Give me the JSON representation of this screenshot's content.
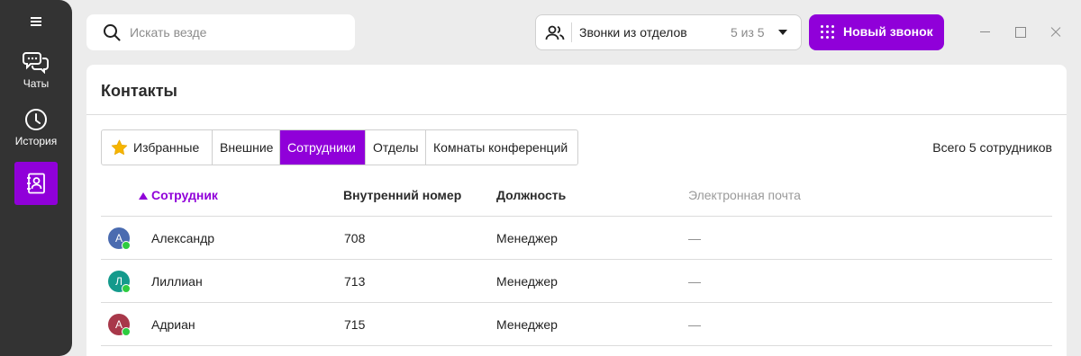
{
  "sidebar": {
    "items": [
      {
        "label": "Чаты",
        "icon": "chat-bubbles-icon"
      },
      {
        "label": "История",
        "icon": "clock-icon"
      },
      {
        "label": "",
        "icon": "contacts-book-icon"
      }
    ]
  },
  "search": {
    "placeholder": "Искать везде"
  },
  "dept_select": {
    "label": "Звонки из отделов",
    "count": "5 из 5"
  },
  "new_call": {
    "label": "Новый звонок"
  },
  "panel": {
    "title": "Контакты"
  },
  "tabs": [
    {
      "label": "Избранные",
      "icon": "star-icon"
    },
    {
      "label": "Внешние"
    },
    {
      "label": "Сотрудники",
      "active": true
    },
    {
      "label": "Отделы"
    },
    {
      "label": "Комнаты конференций"
    }
  ],
  "total": "Всего 5 сотрудников",
  "table": {
    "headers": {
      "name": "Сотрудник",
      "ext": "Внутренний номер",
      "position": "Должность",
      "email": "Электронная почта"
    },
    "rows": [
      {
        "initial": "А",
        "name": "Александр",
        "ext": "708",
        "position": "Менеджер",
        "email": "—",
        "avatar_color": "#4a6bb0"
      },
      {
        "initial": "Л",
        "name": "Лиллиан",
        "ext": "713",
        "position": "Менеджер",
        "email": "—",
        "avatar_color": "#149a8c"
      },
      {
        "initial": "А",
        "name": "Адриан",
        "ext": "715",
        "position": "Менеджер",
        "email": "—",
        "avatar_color": "#a8384a"
      }
    ]
  },
  "colors": {
    "accent": "#9000d9",
    "sidebar": "#333333",
    "online": "#2ecc40"
  }
}
